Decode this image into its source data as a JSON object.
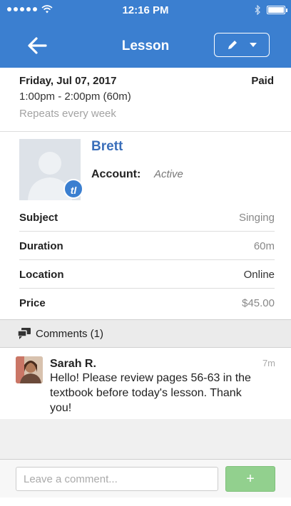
{
  "status": {
    "time": "12:16 PM"
  },
  "header": {
    "title": "Lesson"
  },
  "lesson": {
    "date": "Friday, Jul 07, 2017",
    "payment_status": "Paid",
    "time_range": "1:00pm - 2:00pm (60m)",
    "repeat": "Repeats every week"
  },
  "student": {
    "name": "Brett",
    "account_label": "Account:",
    "account_value": "Active",
    "badge": "tl"
  },
  "details": [
    {
      "label": "Subject",
      "value": "Singing"
    },
    {
      "label": "Duration",
      "value": "60m"
    },
    {
      "label": "Location",
      "value": "Online"
    },
    {
      "label": "Price",
      "value": "$45.00"
    }
  ],
  "comments": {
    "header": "Comments (1)",
    "items": [
      {
        "author": "Sarah R.",
        "age": "7m",
        "text": "Hello! Please review pages 56-63 in the textbook before today's lesson. Thank you!"
      }
    ]
  },
  "composer": {
    "placeholder": "Leave a comment...",
    "send_label": "+"
  },
  "colors": {
    "brand": "#3b7fd0",
    "send": "#92d08e"
  }
}
